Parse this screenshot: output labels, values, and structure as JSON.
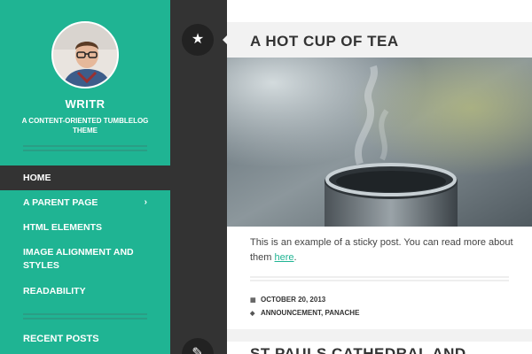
{
  "site": {
    "title": "WRITR",
    "tagline": "A CONTENT-ORIENTED TUMBLELOG THEME",
    "avatar_icon": "person-portrait-icon"
  },
  "nav": {
    "items": [
      {
        "label": "HOME",
        "active": true
      },
      {
        "label": "A PARENT PAGE",
        "has_children": true,
        "caret": "›"
      },
      {
        "label": "HTML ELEMENTS"
      },
      {
        "label": "IMAGE ALIGNMENT AND STYLES"
      },
      {
        "label": "READABILITY"
      }
    ]
  },
  "widgets": {
    "recent_posts_title": "RECENT POSTS"
  },
  "rail": {
    "badge1_icon": "star-icon",
    "badge1_glyph": "★",
    "badge2_icon": "post-format-icon",
    "badge2_glyph": "✎"
  },
  "posts": [
    {
      "title": "A HOT CUP OF TEA",
      "image_icon": "tea-cup-photo",
      "excerpt_prefix": "This is an example of a sticky post. You can read more about them ",
      "excerpt_link": "here",
      "excerpt_suffix": ".",
      "date": "OCTOBER 20, 2013",
      "date_icon": "calendar-icon",
      "categories": "ANNOUNCEMENT, PANACHE",
      "categories_icon": "tag-icon"
    },
    {
      "title": "ST PAULS CATHEDRAL AND"
    }
  ],
  "colors": {
    "accent": "#1fb493",
    "dark": "#333333",
    "darker": "#222222"
  }
}
